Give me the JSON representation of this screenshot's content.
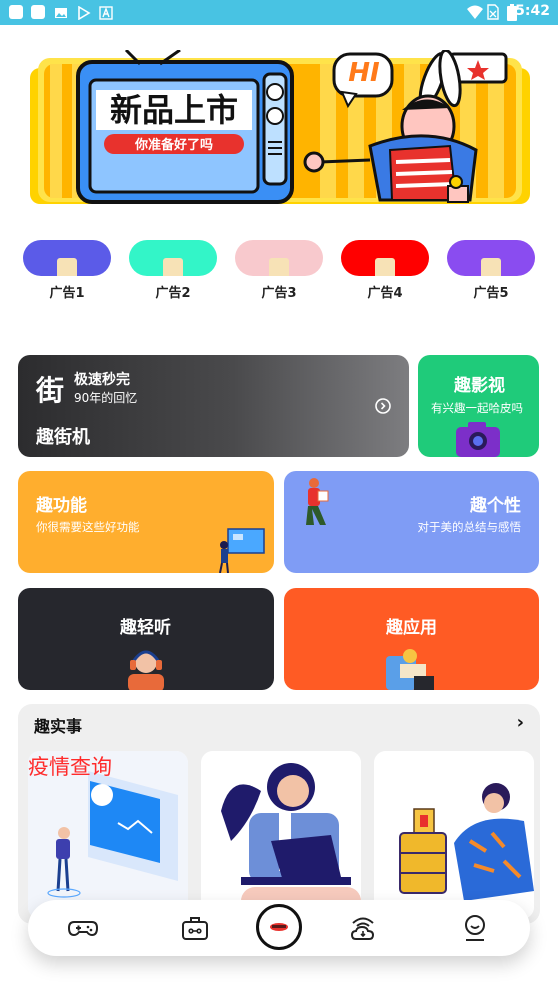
{
  "status_bar": {
    "time": "5:42",
    "icons": [
      "square-icon",
      "square-icon",
      "image-icon",
      "play-store-icon",
      "a-icon",
      "wifi-icon",
      "no-sim-icon",
      "battery-icon"
    ]
  },
  "banner": {
    "headline": "新品上市",
    "tagline": "你准备好了吗",
    "bubble_text": "HI",
    "accent_color": "#ffd200"
  },
  "ads": [
    {
      "label": "广告1",
      "color": "#5b5be8"
    },
    {
      "label": "广告2",
      "color": "#33f5c8"
    },
    {
      "label": "广告3",
      "color": "#f8c9cd"
    },
    {
      "label": "广告4",
      "color": "#ff0000"
    },
    {
      "label": "广告5",
      "color": "#8a4cf0"
    }
  ],
  "cards": {
    "arcade": {
      "glyph": "街",
      "speed": "极速秒完",
      "memory": "90年的回忆",
      "title": "趣街机"
    },
    "video": {
      "title": "趣影视",
      "sub": "有兴趣一起哈皮吗",
      "color": "#1fcb7a"
    },
    "features": {
      "title": "趣功能",
      "sub": "你很需要这些好功能",
      "color": "#ffae2e"
    },
    "personality": {
      "title": "趣个性",
      "sub": "对于美的总结与感悟",
      "color": "#7f9cf5"
    },
    "listen": {
      "title": "趣轻听",
      "color": "#26272d"
    },
    "apps": {
      "title": "趣应用",
      "color": "#ff5b24"
    }
  },
  "news": {
    "title": "趣实事",
    "items": [
      {
        "overlay": "疫情查询"
      },
      {
        "overlay": ""
      },
      {
        "overlay": ""
      }
    ]
  },
  "bottom_nav": {
    "items": [
      "gamepad-icon",
      "toolbox-icon",
      "center-logo-icon",
      "cloud-signal-icon",
      "profile-icon"
    ]
  }
}
